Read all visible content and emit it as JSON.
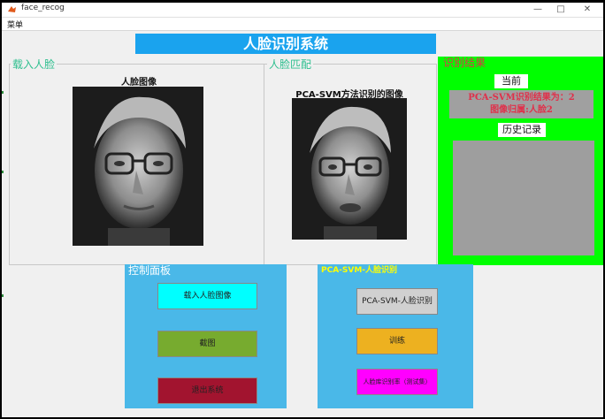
{
  "window": {
    "title": "face_recog"
  },
  "menu": {
    "items": [
      "菜单"
    ]
  },
  "header": {
    "title": "人脸识别系统"
  },
  "load_panel": {
    "legend": "载入人脸",
    "image_label": "人脸图像"
  },
  "match_panel": {
    "legend": "人脸匹配",
    "image_label": "PCA-SVM方法识别的图像"
  },
  "result_panel": {
    "legend": "识别结果",
    "current_label": "当前",
    "result_line1": "PCA-SVM识别结果为：2",
    "result_line2": "图像归属:人脸2",
    "history_label": "历史记录"
  },
  "control_panel": {
    "legend": "控制面板",
    "buttons": [
      "载入人脸图像",
      "截图",
      "退出系统"
    ]
  },
  "pca_panel": {
    "legend": "PCA-SVM-人脸识别",
    "buttons": [
      "PCA-SVM-人脸识别",
      "训练",
      "人脸库识别率（测试集）"
    ]
  },
  "colors": {
    "accent_blue": "#1aa3ee",
    "result_green": "#00ff00",
    "panel_blue": "#4ab8e8",
    "result_text": "#e0304a",
    "btn_cyan": "#00ffff",
    "btn_green": "#77ab2f",
    "btn_red": "#a2142f",
    "btn_gray": "#d0d0d0",
    "btn_orange": "#edb120",
    "btn_magenta": "#ff00ff"
  }
}
